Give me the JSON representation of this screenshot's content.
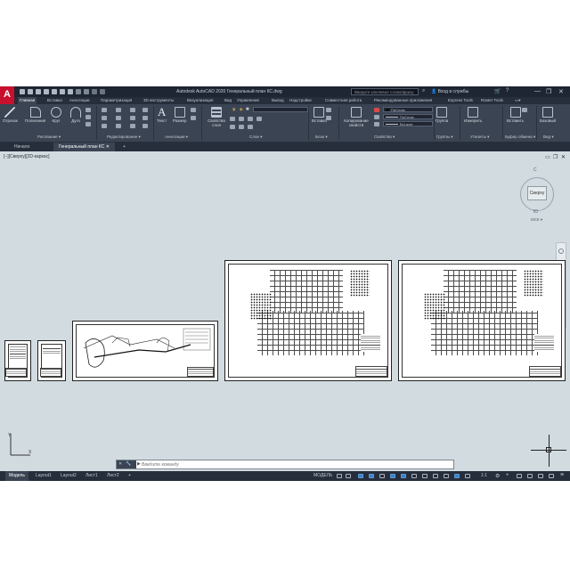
{
  "app": {
    "logo_letter": "A",
    "title": "Autodesk AutoCAD 2020   Генеральный план КС.dwg",
    "search_placeholder": "Введите ключевое слово/фразу",
    "user": "Вход в службы",
    "window_buttons": [
      "—",
      "❐",
      "✕"
    ]
  },
  "ribbon_tabs": [
    "Главная",
    "Вставка",
    "Аннотации",
    "Параметризация",
    "3D инструменты",
    "Визуализация",
    "Вид",
    "Управление",
    "Вывод",
    "Надстройки",
    "Совместная работа",
    "Рекомендованные приложения",
    "Express Tools",
    "Raster Tools"
  ],
  "ribbon": {
    "draw_tools": [
      "Отрезок",
      "Полилиния",
      "Круг",
      "Дуга"
    ],
    "annotation_tools": [
      "Текст",
      "Размер"
    ],
    "layer_props": "Свойства слоя",
    "insert": "Вставка",
    "match_props": "Копирование свойств",
    "layer_dropdown": "ПоСлою",
    "linetype_dropdown": "ПоСлою",
    "lineweight_dropdown": "ByLayer",
    "group": "Группа",
    "measure": "Измерить",
    "paste": "Вставить",
    "base": "Базовый",
    "panels": [
      "Рисование",
      "Редактирование",
      "Аннотации",
      "Слои",
      "Блок",
      "Свойства",
      "Группы",
      "Утилиты",
      "Буфер обмена",
      "Вид"
    ]
  },
  "file_tabs": [
    "Начало",
    "Генеральный план КС"
  ],
  "file_tab_add": "+",
  "viewport": {
    "label": "[−][Сверху][2D-каркас]",
    "cube_face": "Сверху",
    "cube_n": "С",
    "cube_s": "Ю",
    "wcs": "МСК ▾"
  },
  "command": {
    "placeholder": "Введите команду"
  },
  "layout_tabs": [
    "Модель",
    "Layout1",
    "Layout2",
    "Лист1",
    "Лист2"
  ],
  "layout_add": "+",
  "status": {
    "mode": "МОДЕЛЬ",
    "scale": "1:1"
  }
}
